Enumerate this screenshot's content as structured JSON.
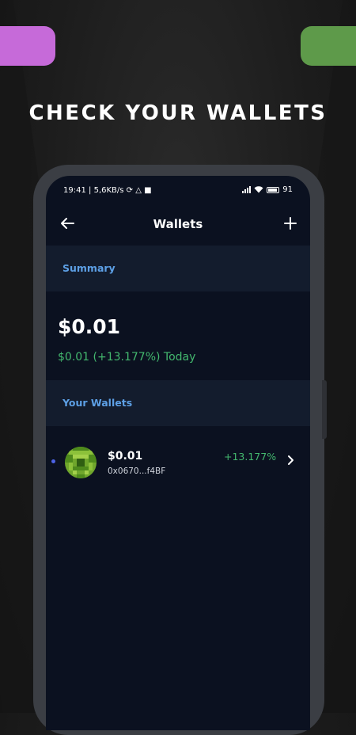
{
  "promo": {
    "headline": "CHECK YOUR WALLETS",
    "accent_left": "#c66ad9",
    "accent_right": "#5e9a4a"
  },
  "status_bar": {
    "time": "19:41",
    "network_speed": "5,6KB/s",
    "battery": "91"
  },
  "app_bar": {
    "title": "Wallets",
    "back_icon": "arrow-left-icon",
    "add_icon": "plus-icon"
  },
  "summary": {
    "section_label": "Summary",
    "total_value": "$0.01",
    "change_text": "$0.01 (+13.177%) Today"
  },
  "wallets": {
    "section_label": "Your Wallets",
    "items": [
      {
        "balance": "$0.01",
        "address": "0x0670...f4BF",
        "change": "+13.177%",
        "avatar_icon": "pixel-identicon"
      }
    ]
  },
  "colors": {
    "screen_background": "#0b1120",
    "section_background": "#131c2d",
    "section_label": "#5da0e6",
    "positive": "#43b86e",
    "active_dot": "#4d63e6"
  }
}
